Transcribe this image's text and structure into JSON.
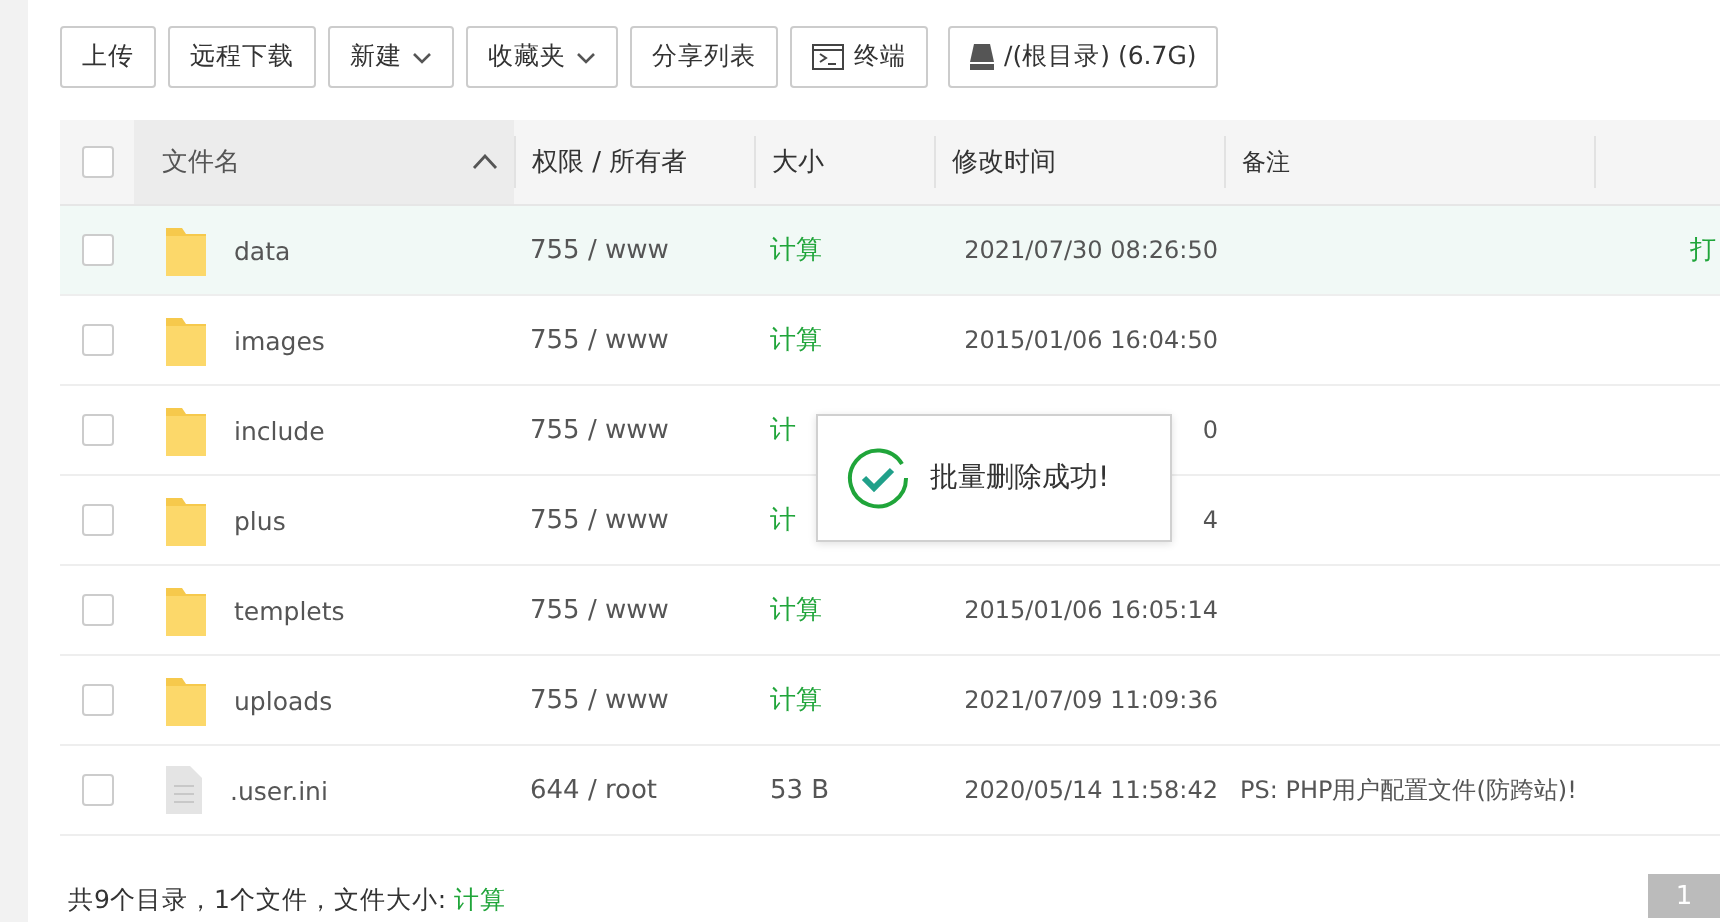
{
  "toolbar": [
    {
      "label": "上传",
      "kind": "text",
      "caret": false
    },
    {
      "label": "远程下载",
      "kind": "text",
      "caret": false
    },
    {
      "label": "新建",
      "kind": "text",
      "caret": true
    },
    {
      "label": "收藏夹",
      "kind": "text",
      "caret": true
    },
    {
      "label": "分享列表",
      "kind": "text",
      "caret": false
    },
    {
      "label": "终端",
      "kind": "terminal",
      "caret": false
    },
    {
      "label": "/(根目录) (6.7G)",
      "kind": "disk",
      "caret": false
    }
  ],
  "table": {
    "all_checked": false,
    "columns": [
      "文件名",
      "权限 / 所有者",
      "大小",
      "修改时间",
      "备注"
    ],
    "rows": [
      {
        "kind": "folder",
        "name": "data",
        "perm": "755 / www",
        "size": "计算",
        "modified": "2021/07/30 08:26:50",
        "note": "",
        "action": "打",
        "selected": true
      },
      {
        "kind": "folder",
        "name": "images",
        "perm": "755 / www",
        "size": "计算",
        "modified": "2015/01/06 16:04:50",
        "note": "",
        "action": "",
        "selected": false
      },
      {
        "kind": "folder",
        "name": "include",
        "perm": "755 / www",
        "size": "计",
        "modified": "0",
        "note": "",
        "action": "",
        "selected": false
      },
      {
        "kind": "folder",
        "name": "plus",
        "perm": "755 / www",
        "size": "计",
        "modified": "4",
        "note": "",
        "action": "",
        "selected": false
      },
      {
        "kind": "folder",
        "name": "templets",
        "perm": "755 / www",
        "size": "计算",
        "modified": "2015/01/06 16:05:14",
        "note": "",
        "action": "",
        "selected": false
      },
      {
        "kind": "folder",
        "name": "uploads",
        "perm": "755 / www",
        "size": "计算",
        "modified": "2021/07/09 11:09:36",
        "note": "",
        "action": "",
        "selected": false
      },
      {
        "kind": "file",
        "name": ".user.ini",
        "perm": "644 / root",
        "size": "53 B",
        "modified": "2020/05/14 11:58:42",
        "note": "PS: PHP用户配置文件(防跨站)!",
        "action": "",
        "selected": false
      }
    ]
  },
  "toast": {
    "message": "批量删除成功!"
  },
  "footer": {
    "summary": "共9个目录，1个文件，文件大小: ",
    "link": "计算",
    "page": "1"
  }
}
